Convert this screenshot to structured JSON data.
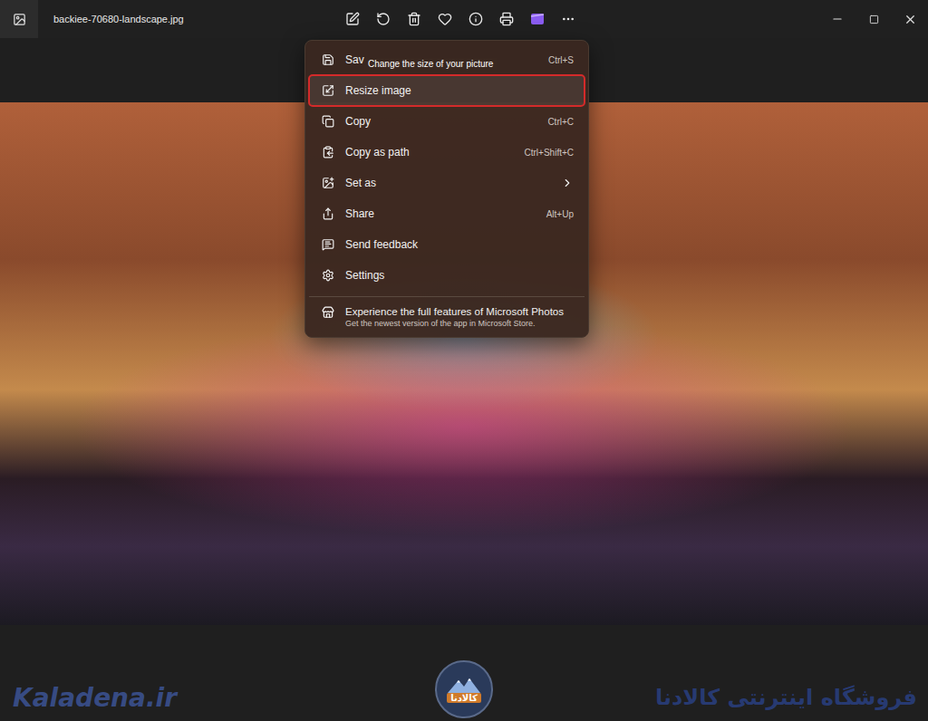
{
  "window": {
    "title": "backiee-70680-landscape.jpg"
  },
  "menu": {
    "items": [
      {
        "label": "Sav",
        "shortcut": "Ctrl+S",
        "selected": false,
        "submenu": false
      },
      {
        "label": "Resize image",
        "shortcut": "",
        "selected": true,
        "submenu": false
      },
      {
        "label": "Copy",
        "shortcut": "Ctrl+C",
        "selected": false,
        "submenu": false
      },
      {
        "label": "Copy as path",
        "shortcut": "Ctrl+Shift+C",
        "selected": false,
        "submenu": false
      },
      {
        "label": "Set as",
        "shortcut": "",
        "selected": false,
        "submenu": true
      },
      {
        "label": "Share",
        "shortcut": "Alt+Up",
        "selected": false,
        "submenu": false
      },
      {
        "label": "Send feedback",
        "shortcut": "",
        "selected": false,
        "submenu": false
      },
      {
        "label": "Settings",
        "shortcut": "",
        "selected": false,
        "submenu": false
      }
    ],
    "promo": {
      "title": "Experience the full features of Microsoft Photos",
      "subtitle": "Get the newest version of the app in Microsoft Store."
    }
  },
  "tooltip": {
    "text": "Change the size of your picture"
  },
  "watermark": {
    "site": "Kaladena.ir",
    "store": "فروشگاه اینترنتی کالادنا",
    "logo": "کالادنا"
  }
}
